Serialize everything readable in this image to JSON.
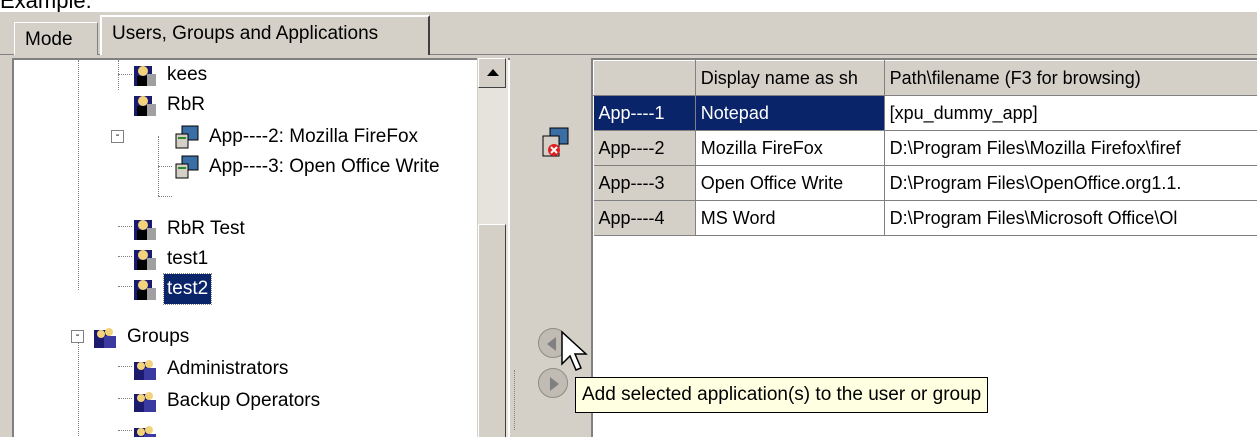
{
  "caption": "Example:",
  "tabs": [
    {
      "label": "Mode"
    },
    {
      "label": "Users, Groups and Applications"
    }
  ],
  "tree": {
    "items": [
      {
        "label": "kees",
        "icon": "user-icon"
      },
      {
        "label": "RbR",
        "icon": "user-icon"
      },
      {
        "label": "App----2: Mozilla FireFox",
        "icon": "application-icon"
      },
      {
        "label": "App----3: Open Office Write",
        "icon": "application-icon"
      },
      {
        "label": "RbR Test",
        "icon": "user-icon"
      },
      {
        "label": "test1",
        "icon": "user-icon"
      },
      {
        "label": "test2",
        "icon": "user-icon",
        "selected": true
      },
      {
        "label": "Groups",
        "icon": "group-icon"
      },
      {
        "label": "Administrators",
        "icon": "group-icon"
      },
      {
        "label": "Backup Operators",
        "icon": "group-icon"
      }
    ],
    "expanders": {
      "rbr": "-",
      "groups": "-"
    }
  },
  "grid": {
    "columns": [
      "",
      "Display name as sh",
      "Path\\filename (F3 for browsing)"
    ],
    "rows": [
      {
        "id": "App----1",
        "name": "Notepad",
        "path": "[xpu_dummy_app]",
        "selected": true
      },
      {
        "id": "App----2",
        "name": "Mozilla FireFox",
        "path": "D:\\Program Files\\Mozilla Firefox\\firef"
      },
      {
        "id": "App----3",
        "name": "Open Office Write",
        "path": "D:\\Program Files\\OpenOffice.org1.1."
      },
      {
        "id": "App----4",
        "name": "MS Word",
        "path": "D:\\Program Files\\Microsoft Office\\Ol"
      }
    ]
  },
  "tooltip": "Add selected application(s) to the user or group",
  "colors": {
    "selection": "#0a246a",
    "face": "#d4d0c8",
    "tooltip_bg": "#ffffe1"
  }
}
